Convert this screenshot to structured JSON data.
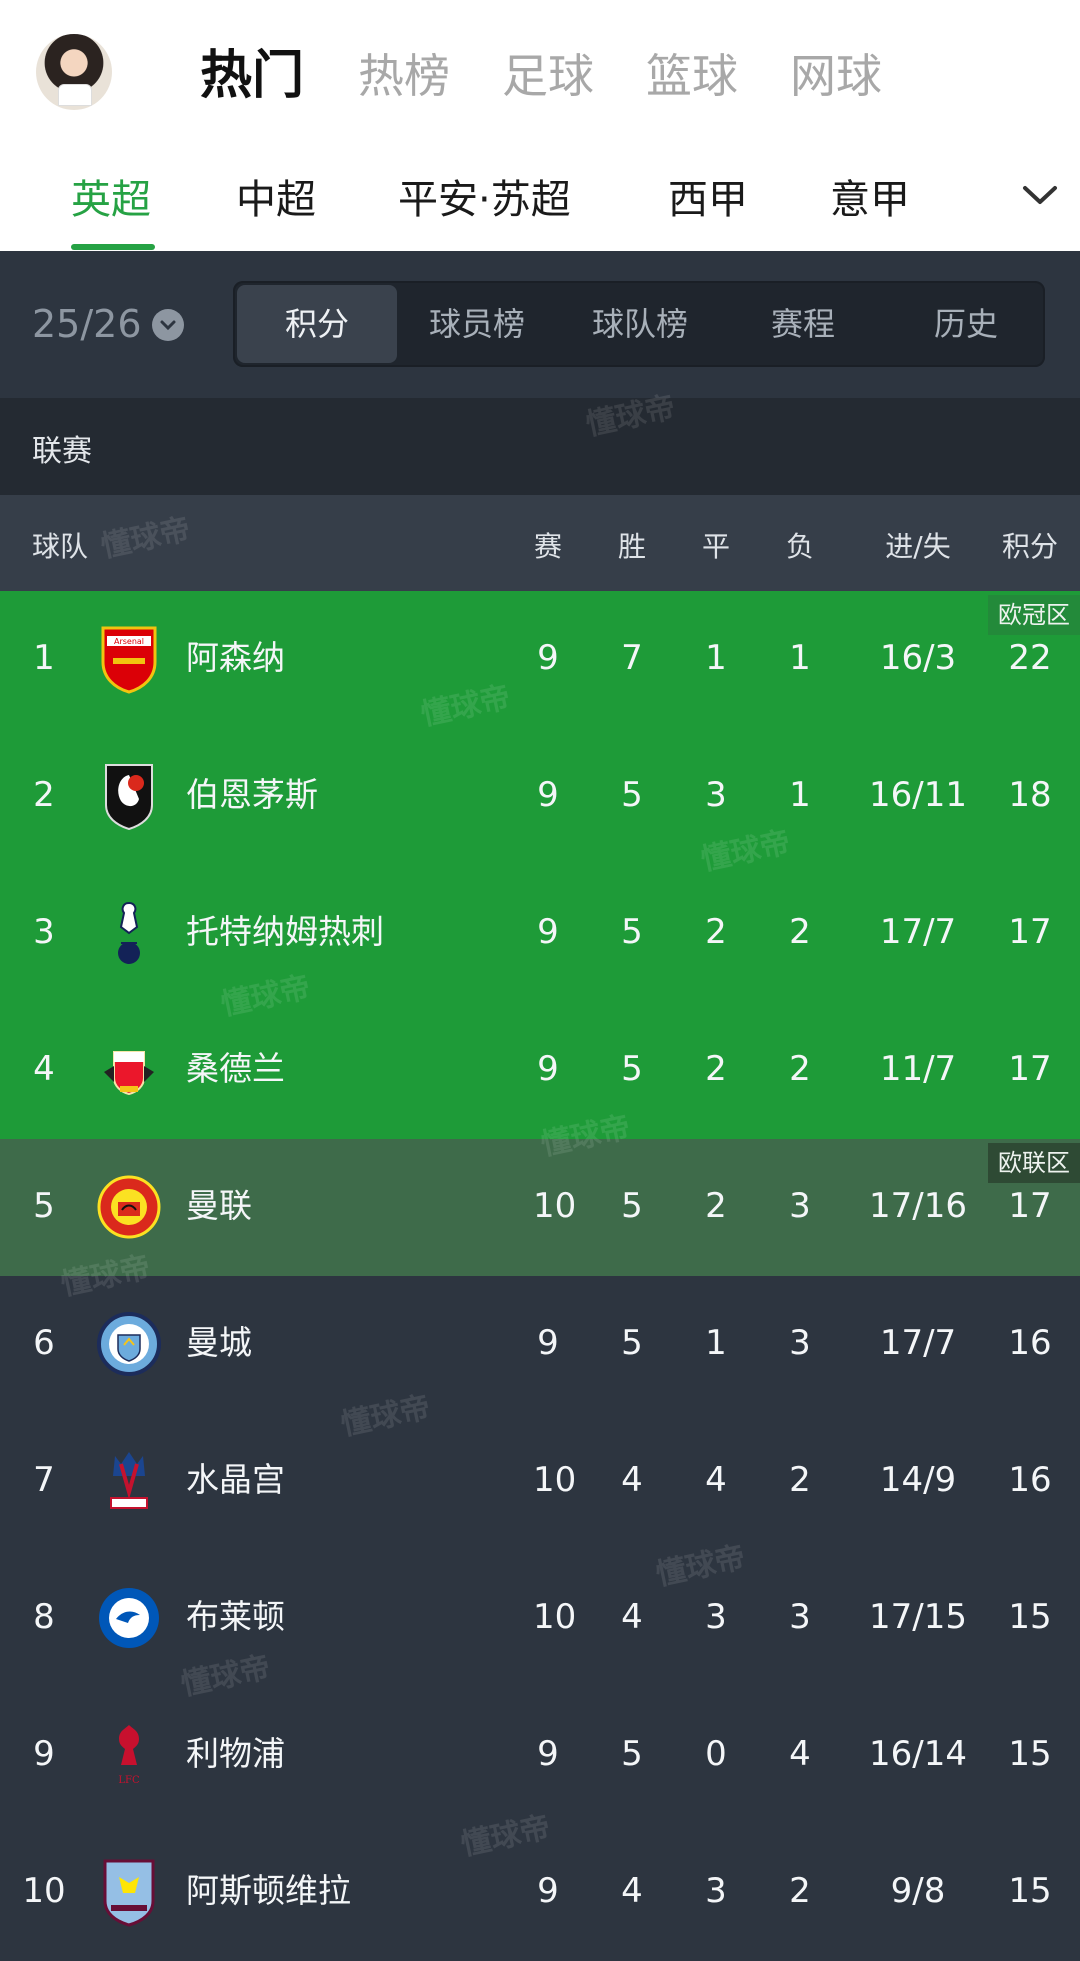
{
  "top_nav": {
    "items": [
      "热门",
      "热榜",
      "足球",
      "篮球",
      "网球"
    ],
    "active": "热门"
  },
  "league_tabs": {
    "items": [
      "英超",
      "中超",
      "平安·苏超",
      "西甲",
      "意甲"
    ],
    "active": "英超"
  },
  "season": "25/26",
  "view_tabs": [
    "积分",
    "球员榜",
    "球队榜",
    "赛程",
    "历史"
  ],
  "section_label": "联赛",
  "columns": [
    "球队",
    "赛",
    "胜",
    "平",
    "负",
    "进/失",
    "积分"
  ],
  "zones": {
    "ucl": "欧冠区",
    "uel": "欧联区"
  },
  "standings": [
    {
      "rank": "1",
      "team": "阿森纳",
      "p": "9",
      "w": "7",
      "d": "1",
      "l": "1",
      "gfga": "16/3",
      "pts": "22",
      "zone": "ucl",
      "badge_icon": "arsenal-badge-icon"
    },
    {
      "rank": "2",
      "team": "伯恩茅斯",
      "p": "9",
      "w": "5",
      "d": "3",
      "l": "1",
      "gfga": "16/11",
      "pts": "18",
      "zone": "ucl",
      "badge_icon": "bournemouth-badge-icon"
    },
    {
      "rank": "3",
      "team": "托特纳姆热刺",
      "p": "9",
      "w": "5",
      "d": "2",
      "l": "2",
      "gfga": "17/7",
      "pts": "17",
      "zone": "ucl",
      "badge_icon": "tottenham-badge-icon"
    },
    {
      "rank": "4",
      "team": "桑德兰",
      "p": "9",
      "w": "5",
      "d": "2",
      "l": "2",
      "gfga": "11/7",
      "pts": "17",
      "zone": "ucl",
      "badge_icon": "sunderland-badge-icon"
    },
    {
      "rank": "5",
      "team": "曼联",
      "p": "10",
      "w": "5",
      "d": "2",
      "l": "3",
      "gfga": "17/16",
      "pts": "17",
      "zone": "uel",
      "badge_icon": "man-utd-badge-icon"
    },
    {
      "rank": "6",
      "team": "曼城",
      "p": "9",
      "w": "5",
      "d": "1",
      "l": "3",
      "gfga": "17/7",
      "pts": "16",
      "zone": "",
      "badge_icon": "man-city-badge-icon"
    },
    {
      "rank": "7",
      "team": "水晶宫",
      "p": "10",
      "w": "4",
      "d": "4",
      "l": "2",
      "gfga": "14/9",
      "pts": "16",
      "zone": "",
      "badge_icon": "crystal-palace-badge-icon"
    },
    {
      "rank": "8",
      "team": "布莱顿",
      "p": "10",
      "w": "4",
      "d": "3",
      "l": "3",
      "gfga": "17/15",
      "pts": "15",
      "zone": "",
      "badge_icon": "brighton-badge-icon"
    },
    {
      "rank": "9",
      "team": "利物浦",
      "p": "9",
      "w": "5",
      "d": "0",
      "l": "4",
      "gfga": "16/14",
      "pts": "15",
      "zone": "",
      "badge_icon": "liverpool-badge-icon"
    },
    {
      "rank": "10",
      "team": "阿斯顿维拉",
      "p": "9",
      "w": "4",
      "d": "3",
      "l": "2",
      "gfga": "9/8",
      "pts": "15",
      "zone": "",
      "badge_icon": "aston-villa-badge-icon"
    }
  ],
  "watermark_text": "懂球帝",
  "colors": {
    "accent_green": "#26a244",
    "ucl_zone": "#1e9b38",
    "uel_zone": "#3e6b4a",
    "dark_bg": "#2d3540"
  }
}
